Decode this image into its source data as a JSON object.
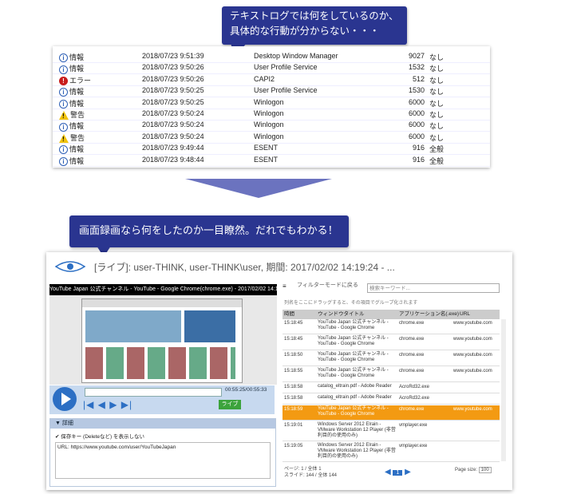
{
  "callout_top": {
    "line1": "テキストログでは何をしているのか、",
    "line2": "具体的な行動が分からない・・・"
  },
  "callout_bottom": "画面録画なら何をしたのか一目瞭然。だれでもわかる！",
  "event_log": [
    {
      "level": "情報",
      "type": "info",
      "datetime": "2018/07/23 9:51:39",
      "source": "Desktop Window Manager",
      "id": "9027",
      "category": "なし"
    },
    {
      "level": "情報",
      "type": "info",
      "datetime": "2018/07/23 9:50:26",
      "source": "User Profile Service",
      "id": "1532",
      "category": "なし"
    },
    {
      "level": "エラー",
      "type": "err",
      "datetime": "2018/07/23 9:50:26",
      "source": "CAPI2",
      "id": "512",
      "category": "なし"
    },
    {
      "level": "情報",
      "type": "info",
      "datetime": "2018/07/23 9:50:25",
      "source": "User Profile Service",
      "id": "1530",
      "category": "なし"
    },
    {
      "level": "情報",
      "type": "info",
      "datetime": "2018/07/23 9:50:25",
      "source": "Winlogon",
      "id": "6000",
      "category": "なし"
    },
    {
      "level": "警告",
      "type": "warn",
      "datetime": "2018/07/23 9:50:24",
      "source": "Winlogon",
      "id": "6000",
      "category": "なし"
    },
    {
      "level": "情報",
      "type": "info",
      "datetime": "2018/07/23 9:50:24",
      "source": "Winlogon",
      "id": "6000",
      "category": "なし"
    },
    {
      "level": "警告",
      "type": "warn",
      "datetime": "2018/07/23 9:50:24",
      "source": "Winlogon",
      "id": "6000",
      "category": "なし"
    },
    {
      "level": "情報",
      "type": "info",
      "datetime": "2018/07/23 9:49:44",
      "source": "ESENT",
      "id": "916",
      "category": "全般"
    },
    {
      "level": "情報",
      "type": "info",
      "datetime": "2018/07/23 9:48:44",
      "source": "ESENT",
      "id": "916",
      "category": "全般"
    }
  ],
  "window": {
    "title": "[ライブ]: user-THINK, user-THINK\\user, 期間: 2017/02/02 14:19:24 - ...",
    "video_title": "YouTube Japan 公式チャンネル - YouTube - Google Chrome(chrome.exe) - 2017/02/02 14:19:24",
    "time": "00:55:25/00:55:33",
    "nav_buttons": "|◀ ◀ ▶ ▶|",
    "live_label": "ライブ",
    "detail_header": "▼ 詳細",
    "detail_checkbox": "✔ 保存キー (Deleteなど) を表示しない",
    "detail_url": "URL: https://www.youtube.com/user/YouTubeJapan",
    "filter_label": "フィルターモードに戻る",
    "search_placeholder": "検索キーワード...",
    "group_hint": "列名をここにドラッグすると、その項目でグループ化されます",
    "columns": {
      "time": "時間",
      "window": "ウィンドウタイトル",
      "app": "アプリケーション名(.exe)",
      "url": "URL"
    },
    "rows": [
      {
        "time": "15:18:45",
        "window": "YouTube Japan 公式チャンネル - YouTube - Google Chrome",
        "app": "chrome.exe",
        "url": "www.youtube.com",
        "sel": false
      },
      {
        "time": "15:18:45",
        "window": "YouTube Japan 公式チャンネル - YouTube - Google Chrome",
        "app": "chrome.exe",
        "url": "www.youtube.com",
        "sel": false
      },
      {
        "time": "15:18:50",
        "window": "YouTube Japan 公式チャンネル - YouTube - Google Chrome",
        "app": "chrome.exe",
        "url": "www.youtube.com",
        "sel": false
      },
      {
        "time": "15:18:55",
        "window": "YouTube Japan 公式チャンネル - YouTube - Google Chrome",
        "app": "chrome.exe",
        "url": "www.youtube.com",
        "sel": false
      },
      {
        "time": "15:18:58",
        "window": "catalog_eltrain.pdf - Adobe Reader",
        "app": "AcroRd32.exe",
        "url": "",
        "sel": false
      },
      {
        "time": "15:18:58",
        "window": "catalog_eltrain.pdf - Adobe Reader",
        "app": "AcroRd32.exe",
        "url": "",
        "sel": false
      },
      {
        "time": "15:18:59",
        "window": "YouTube Japan 公式チャンネル - YouTube - Google Chrome",
        "app": "chrome.exe",
        "url": "www.youtube.com",
        "sel": true
      },
      {
        "time": "15:19:01",
        "window": "Windows Server 2012 Elrain - VMware Workstation 12 Player (非営利目的の使用のみ)",
        "app": "vmplayer.exe",
        "url": "",
        "sel": false
      },
      {
        "time": "15:19:05",
        "window": "Windows Server 2012 Elrain - VMware Workstation 12 Player (非営利目的の使用のみ)",
        "app": "vmplayer.exe",
        "url": "",
        "sel": false
      }
    ],
    "pager_line1": "ページ: 1 / 全体 1",
    "pager_line2": "スライド: 144 / 全体 144",
    "page_num": "1",
    "page_size_label": "Page size:",
    "page_size_value": "100"
  }
}
